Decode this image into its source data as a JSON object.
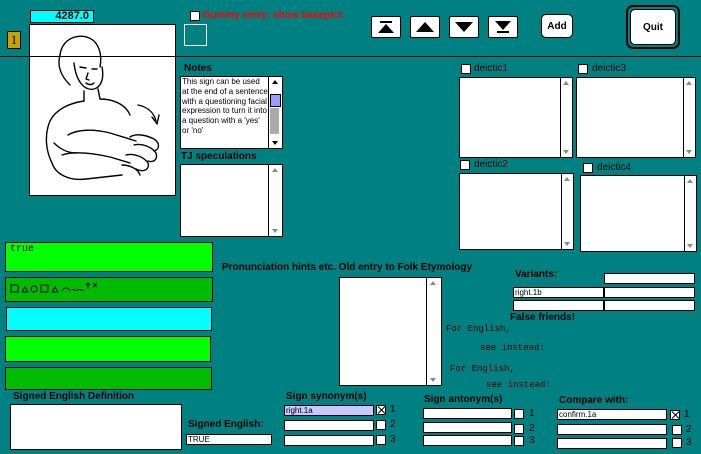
{
  "header": {
    "record_number": "4287.0",
    "page_badge": "1",
    "dummy_label": "Dummy entry: show basepict"
  },
  "nav": {
    "add_label": "Add",
    "quit_label": "Quit"
  },
  "notes": {
    "title": "Notes",
    "text": "This sign can be used at the end of a sentence with a questioning facial expression to turn it into a question with a 'yes' or 'no'"
  },
  "tj": {
    "title": "TJ speculations",
    "text": ""
  },
  "deictic": {
    "d1": "deictic1",
    "d2": "deictic2",
    "d3": "deictic3",
    "d4": "deictic4"
  },
  "gloss": {
    "value": "true"
  },
  "pronunciation": {
    "title": "Pronunciation hints etc. Old entry to Folk Etymology"
  },
  "variants": {
    "title": "Variants:",
    "items": [
      "",
      "right.1b",
      ""
    ]
  },
  "false_friends": {
    "title": "False friends!",
    "for_english_1": "For English,",
    "see_instead_1": "see instead:",
    "for_english_2": "For English,",
    "see_instead_2": "see instead:"
  },
  "signed_def": {
    "title": "Signed English Definition"
  },
  "signed_english": {
    "label": "Signed English:",
    "value": "TRUE"
  },
  "synonyms": {
    "title": "Sign synonym(s)",
    "items": [
      "right.1a",
      "",
      ""
    ]
  },
  "antonyms": {
    "title": "Sign antonym(s)",
    "items": [
      "",
      "",
      ""
    ]
  },
  "compare": {
    "title": "Compare with:",
    "items": [
      "confirm.1a",
      "",
      ""
    ]
  },
  "row_numbers": [
    "1",
    "2",
    "3"
  ],
  "colors": {
    "background": "#008080",
    "green": "#00ff00",
    "dark_green": "#00bb00",
    "cyan": "#00ffff",
    "red": "#ff0000"
  }
}
